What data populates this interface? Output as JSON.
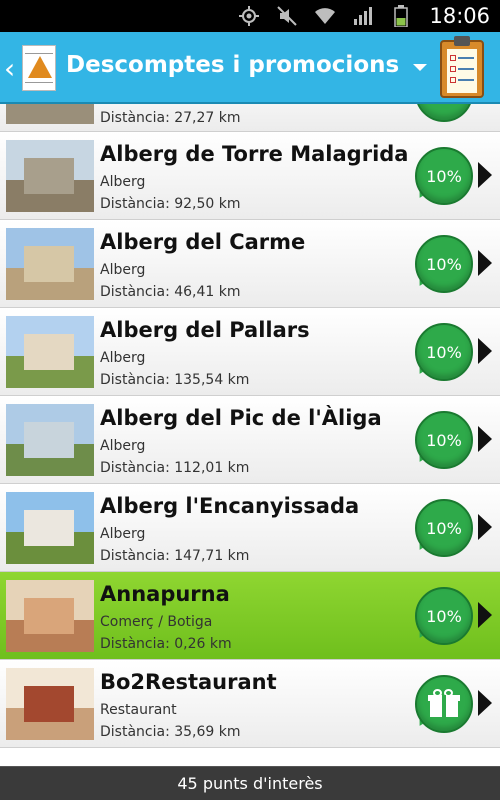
{
  "status_bar": {
    "time": "18:06",
    "icons": [
      "gps-icon",
      "mute-icon",
      "wifi-icon",
      "signal-icon",
      "battery-icon"
    ]
  },
  "header": {
    "title": "Descomptes i promocions",
    "back_icon": "chevron-left-icon",
    "menu_icon": "clipboard-icon"
  },
  "list": {
    "partial_first": {
      "distance": "Distància: 27,27 km"
    },
    "items": [
      {
        "name": "Alberg de Torre Malagrida",
        "category": "Alberg",
        "distance": "Distància: 92,50 km",
        "badge": "10%",
        "badge_type": "discount"
      },
      {
        "name": "Alberg del Carme",
        "category": "Alberg",
        "distance": "Distància: 46,41 km",
        "badge": "10%",
        "badge_type": "discount"
      },
      {
        "name": "Alberg del Pallars",
        "category": "Alberg",
        "distance": "Distància: 135,54 km",
        "badge": "10%",
        "badge_type": "discount"
      },
      {
        "name": "Alberg del Pic de l'Àliga",
        "category": "Alberg",
        "distance": "Distància: 112,01 km",
        "badge": "10%",
        "badge_type": "discount"
      },
      {
        "name": "Alberg l'Encanyissada",
        "category": "Alberg",
        "distance": "Distància: 147,71 km",
        "badge": "10%",
        "badge_type": "discount"
      },
      {
        "name": "Annapurna",
        "category": "Comerç / Botiga",
        "distance": "Distància: 0,26 km",
        "badge": "10%",
        "badge_type": "discount",
        "highlighted": true
      },
      {
        "name": "Bo2Restaurant",
        "category": "Restaurant",
        "distance": "Distància: 35,69 km",
        "badge": "",
        "badge_type": "gift"
      }
    ]
  },
  "footer": {
    "count_label": "45 punts d'interès"
  },
  "colors": {
    "action_bar": "#33b5e5",
    "badge_green": "#2eaa4a",
    "highlight_green": "#7cc927"
  }
}
